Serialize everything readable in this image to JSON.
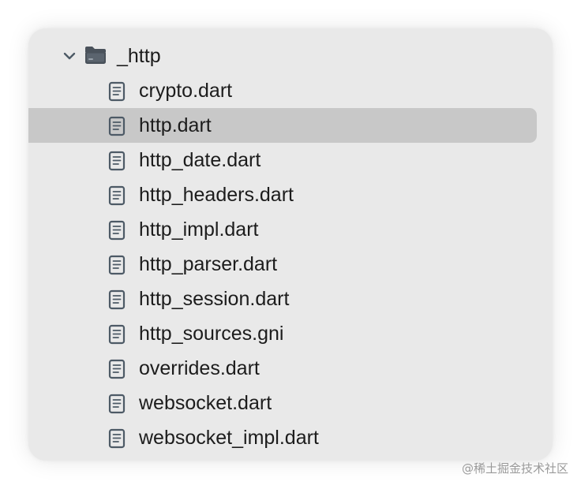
{
  "tree": {
    "folder": {
      "label": "_http",
      "icon": "folder-icon",
      "expanded": true,
      "chevron_icon": "chevron-down-icon"
    },
    "files": [
      {
        "label": "crypto.dart",
        "icon": "document-icon",
        "selected": false
      },
      {
        "label": "http.dart",
        "icon": "document-icon",
        "selected": true
      },
      {
        "label": "http_date.dart",
        "icon": "document-icon",
        "selected": false
      },
      {
        "label": "http_headers.dart",
        "icon": "document-icon",
        "selected": false
      },
      {
        "label": "http_impl.dart",
        "icon": "document-icon",
        "selected": false
      },
      {
        "label": "http_parser.dart",
        "icon": "document-icon",
        "selected": false
      },
      {
        "label": "http_session.dart",
        "icon": "document-icon",
        "selected": false
      },
      {
        "label": "http_sources.gni",
        "icon": "document-icon",
        "selected": false
      },
      {
        "label": "overrides.dart",
        "icon": "document-icon",
        "selected": false
      },
      {
        "label": "websocket.dart",
        "icon": "document-icon",
        "selected": false
      },
      {
        "label": "websocket_impl.dart",
        "icon": "document-icon",
        "selected": false
      }
    ]
  },
  "watermark": "@稀土掘金技术社区",
  "colors": {
    "panel_background": "#e9e9e9",
    "selected_row": "#c8c8c8",
    "icon_stroke": "#4d5a66",
    "folder_fill": "#4a525b",
    "text": "#1c1c1c"
  }
}
